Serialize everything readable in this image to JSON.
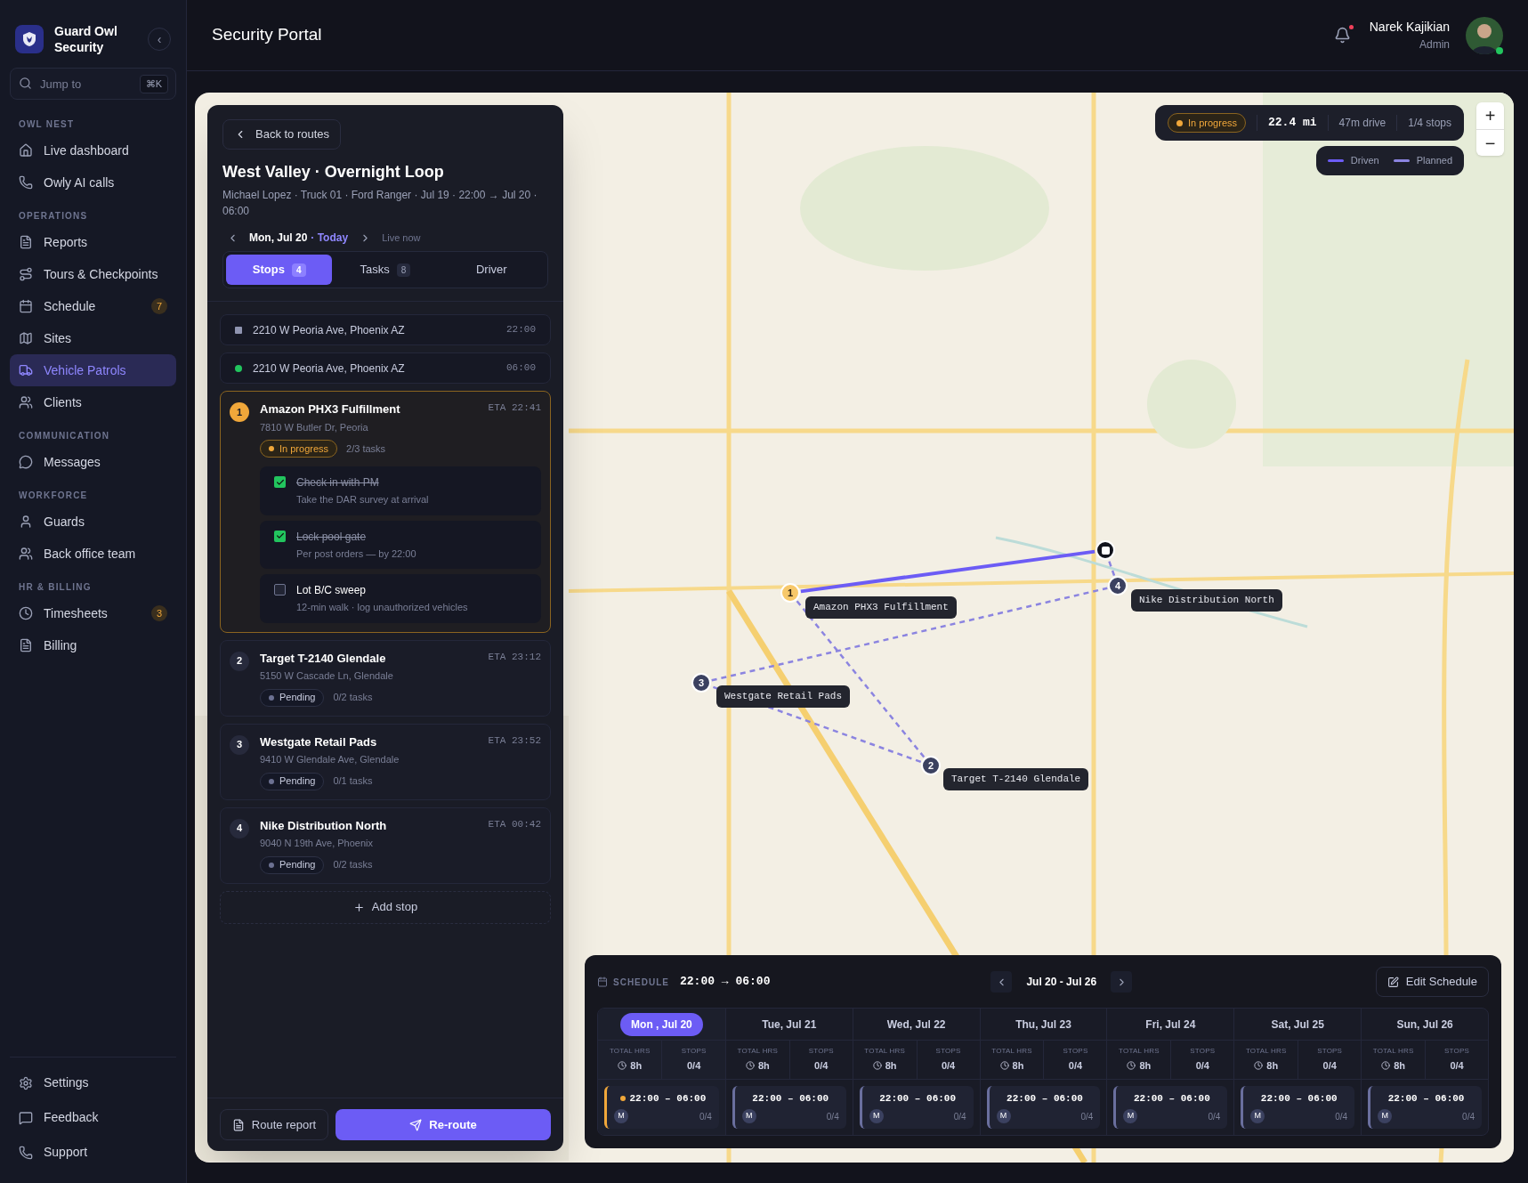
{
  "brand": {
    "name": "Guard Owl Security",
    "collapse": "‹"
  },
  "search": {
    "placeholder": "Jump to",
    "shortcut": "⌘K"
  },
  "nav_sections": [
    {
      "title": "OWL NEST",
      "items": [
        {
          "label": "Live dashboard",
          "selected": false
        },
        {
          "label": "Owly AI calls",
          "selected": false
        }
      ]
    },
    {
      "title": "OPERATIONS",
      "items": [
        {
          "label": "Reports",
          "selected": false
        },
        {
          "label": "Tours & Checkpoints",
          "selected": false
        },
        {
          "label": "Schedule",
          "badge": "7",
          "selected": false
        },
        {
          "label": "Sites",
          "selected": false
        },
        {
          "label": "Vehicle Patrols",
          "selected": true
        },
        {
          "label": "Clients",
          "selected": false
        }
      ]
    },
    {
      "title": "COMMUNICATION",
      "items": [
        {
          "label": "Messages",
          "selected": false
        }
      ]
    },
    {
      "title": "WORKFORCE",
      "items": [
        {
          "label": "Guards",
          "selected": false
        },
        {
          "label": "Back office team",
          "selected": false
        }
      ]
    },
    {
      "title": "HR & BILLING",
      "items": [
        {
          "label": "Timesheets",
          "badge": "3",
          "selected": false
        },
        {
          "label": "Billing",
          "selected": false
        }
      ]
    }
  ],
  "footer_nav": [
    {
      "label": "Settings"
    },
    {
      "label": "Feedback"
    },
    {
      "label": "Support"
    }
  ],
  "header": {
    "title": "Security Portal",
    "user_name": "Narek Kajikian",
    "user_role": "Admin",
    "notification_unread": true,
    "online": true
  },
  "route_panel": {
    "back": "Back to routes",
    "title": "West Valley · Overnight Loop",
    "meta": "Michael Lopez · Truck 01 · Ford Ranger · Jul 19 · 22:00 → Jul 20 · 06:00",
    "date": "Mon, Jul 20",
    "today": "· Today",
    "live": "Live now",
    "tabs": [
      {
        "label": "Stops",
        "count": "4",
        "selected": true
      },
      {
        "label": "Tasks",
        "count": "8",
        "selected": false
      },
      {
        "label": "Driver",
        "selected": false
      }
    ],
    "endpoints": [
      {
        "kind": "start",
        "address": "2210 W Peoria Ave, Phoenix AZ",
        "time": "22:00"
      },
      {
        "kind": "end",
        "address": "2210 W Peoria Ave, Phoenix AZ",
        "time": "06:00"
      }
    ],
    "stops": [
      {
        "number": "1",
        "name": "Amazon PHX3 Fulfillment",
        "address": "7810 W Butler Dr, Peoria",
        "eta": "ETA 22:41",
        "status": {
          "kind": "in_progress",
          "label": "In progress"
        },
        "tasks_count": "2/3 tasks",
        "tasks": [
          {
            "title": "Check in with PM",
            "note": "Take the DAR survey at arrival",
            "checked": true
          },
          {
            "title": "Lock pool gate",
            "note": "Per post orders — by 22:00",
            "checked": true
          },
          {
            "title": "Lot B/C sweep",
            "note": "12-min walk · log unauthorized vehicles",
            "checked": false
          }
        ]
      },
      {
        "number": "2",
        "name": "Target T-2140 Glendale",
        "address": "5150 W Cascade Ln, Glendale",
        "eta": "ETA 23:12",
        "status": {
          "kind": "pending",
          "label": "Pending"
        },
        "tasks_count": "0/2 tasks"
      },
      {
        "number": "3",
        "name": "Westgate Retail Pads",
        "address": "9410 W Glendale Ave, Glendale",
        "eta": "ETA 23:52",
        "status": {
          "kind": "pending",
          "label": "Pending"
        },
        "tasks_count": "0/1 tasks"
      },
      {
        "number": "4",
        "name": "Nike Distribution North",
        "address": "9040 N 19th Ave, Phoenix",
        "eta": "ETA 00:42",
        "status": {
          "kind": "pending",
          "label": "Pending"
        },
        "tasks_count": "0/2 tasks"
      }
    ],
    "add_stop": "Add stop",
    "report": "Route report",
    "reroute": "Re-route"
  },
  "map": {
    "summary": {
      "status": "In progress",
      "distance": "22.4 mi",
      "drive": "47m drive",
      "stops": "1/4 stops"
    },
    "legend": [
      {
        "kind": "driven",
        "label": "Driven"
      },
      {
        "kind": "planned",
        "label": "Planned"
      }
    ],
    "zoom": [
      "+",
      "−"
    ],
    "markers": [
      {
        "kind": "start"
      },
      {
        "kind": "current",
        "number": "1",
        "label": "Amazon PHX3 Fulfillment"
      },
      {
        "kind": "pending",
        "number": "2",
        "label": "Target T-2140 Glendale"
      },
      {
        "kind": "pending",
        "number": "3",
        "label": "Westgate Retail Pads"
      },
      {
        "kind": "pending",
        "number": "4",
        "label": "Nike Distribution North"
      }
    ]
  },
  "schedule": {
    "label": "SCHEDULE",
    "hours": "22:00 → 06:00",
    "range": "Jul 20 - Jul 26",
    "edit": "Edit Schedule",
    "days": [
      {
        "label": "Mon , Jul 20",
        "selected": true,
        "total_label": "TOTAL HRS",
        "total": "8h",
        "stops_label": "STOPS",
        "stops": "0/4",
        "shift": "22:00 – 06:00",
        "guard": "M",
        "progress": "0/4",
        "active": true
      },
      {
        "label": "Tue, Jul 21",
        "selected": false,
        "total_label": "TOTAL HRS",
        "total": "8h",
        "stops_label": "STOPS",
        "stops": "0/4",
        "shift": "22:00 – 06:00",
        "guard": "M",
        "progress": "0/4",
        "active": false
      },
      {
        "label": "Wed, Jul 22",
        "selected": false,
        "total_label": "TOTAL HRS",
        "total": "8h",
        "stops_label": "STOPS",
        "stops": "0/4",
        "shift": "22:00 – 06:00",
        "guard": "M",
        "progress": "0/4",
        "active": false
      },
      {
        "label": "Thu, Jul 23",
        "selected": false,
        "total_label": "TOTAL HRS",
        "total": "8h",
        "stops_label": "STOPS",
        "stops": "0/4",
        "shift": "22:00 – 06:00",
        "guard": "M",
        "progress": "0/4",
        "active": false
      },
      {
        "label": "Fri, Jul 24",
        "selected": false,
        "total_label": "TOTAL HRS",
        "total": "8h",
        "stops_label": "STOPS",
        "stops": "0/4",
        "shift": "22:00 – 06:00",
        "guard": "M",
        "progress": "0/4",
        "active": false
      },
      {
        "label": "Sat, Jul 25",
        "selected": false,
        "total_label": "TOTAL HRS",
        "total": "8h",
        "stops_label": "STOPS",
        "stops": "0/4",
        "shift": "22:00 – 06:00",
        "guard": "M",
        "progress": "0/4",
        "active": false
      },
      {
        "label": "Sun, Jul 26",
        "selected": false,
        "total_label": "TOTAL HRS",
        "total": "8h",
        "stops_label": "STOPS",
        "stops": "0/4",
        "shift": "22:00 – 06:00",
        "guard": "M",
        "progress": "0/4",
        "active": false
      }
    ]
  }
}
